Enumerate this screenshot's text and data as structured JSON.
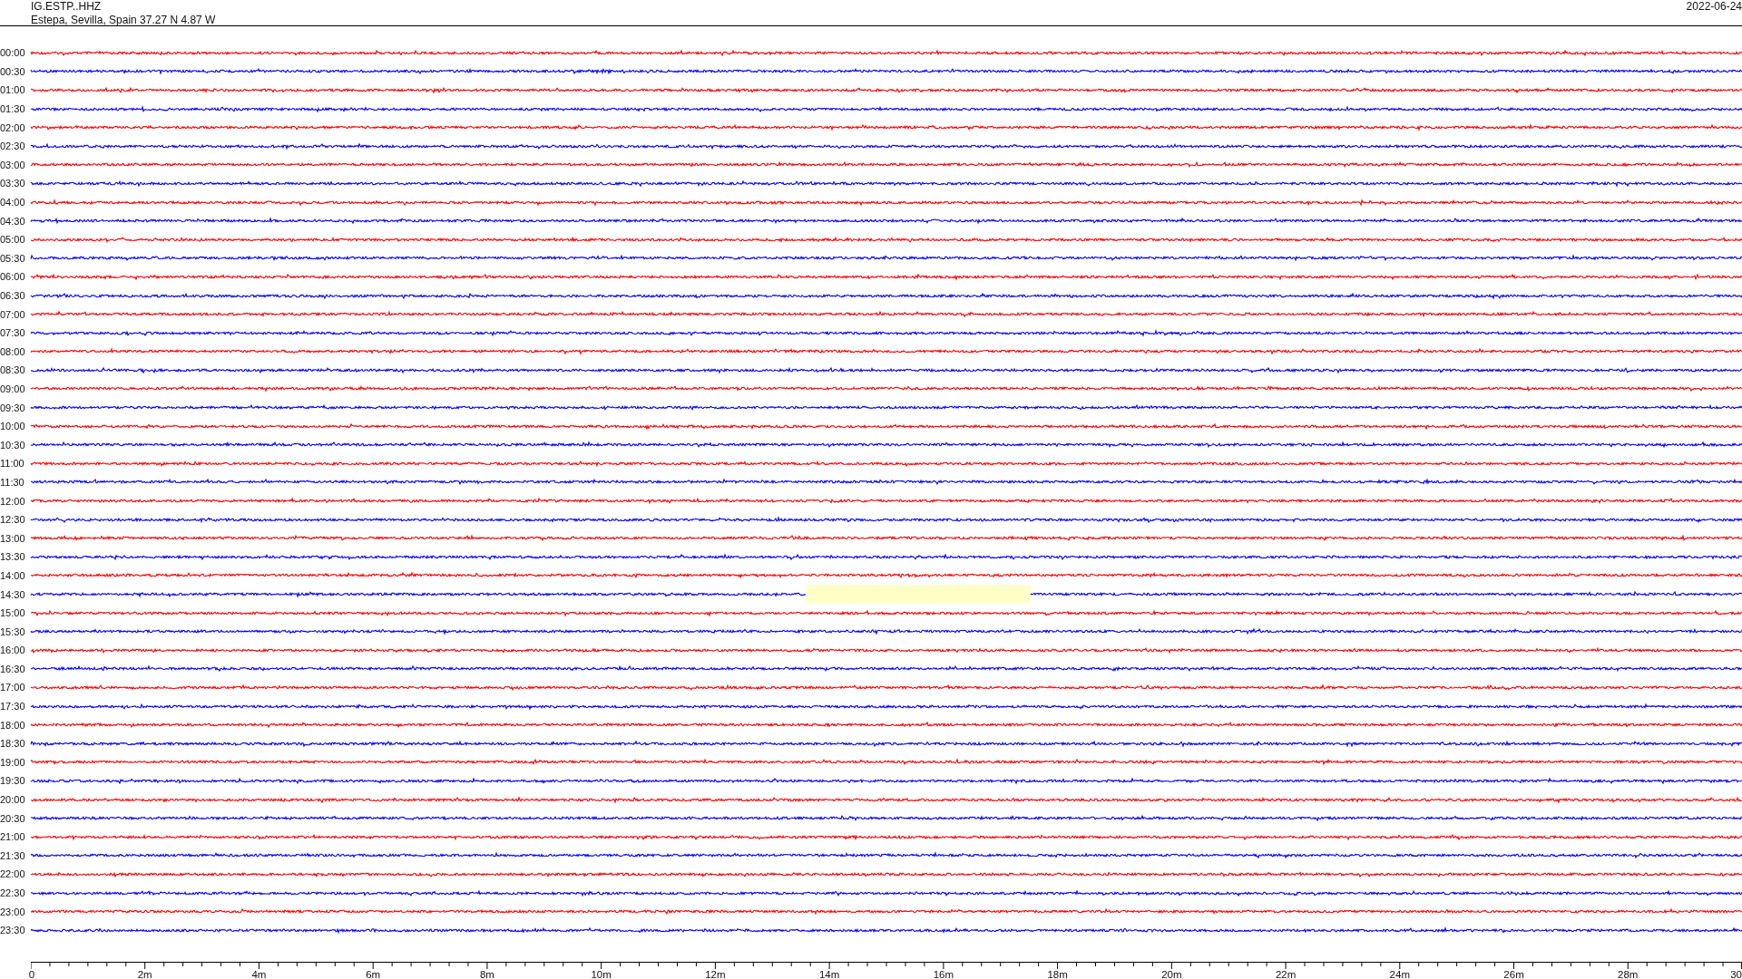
{
  "header": {
    "station": "IG.ESTP..HHZ",
    "location": "Estepa, Sevilla, Spain  37.27 N 4.87 W",
    "date": "2022-06-24"
  },
  "rows": [
    {
      "label": "00:00",
      "color": "#ff0000"
    },
    {
      "label": "00:30",
      "color": "#0000ff"
    },
    {
      "label": "01:00",
      "color": "#ff0000"
    },
    {
      "label": "01:30",
      "color": "#0000ff"
    },
    {
      "label": "02:00",
      "color": "#ff0000"
    },
    {
      "label": "02:30",
      "color": "#0000ff"
    },
    {
      "label": "03:00",
      "color": "#ff0000"
    },
    {
      "label": "03:30",
      "color": "#0000ff"
    },
    {
      "label": "04:00",
      "color": "#ff0000"
    },
    {
      "label": "04:30",
      "color": "#0000ff"
    },
    {
      "label": "05:00",
      "color": "#ff0000"
    },
    {
      "label": "05:30",
      "color": "#0000ff"
    },
    {
      "label": "06:00",
      "color": "#ff0000"
    },
    {
      "label": "06:30",
      "color": "#0000ff"
    },
    {
      "label": "07:00",
      "color": "#ff0000"
    },
    {
      "label": "07:30",
      "color": "#0000ff"
    },
    {
      "label": "08:00",
      "color": "#ff0000"
    },
    {
      "label": "08:30",
      "color": "#0000ff"
    },
    {
      "label": "09:00",
      "color": "#ff0000"
    },
    {
      "label": "09:30",
      "color": "#0000ff"
    },
    {
      "label": "10:00",
      "color": "#ff0000"
    },
    {
      "label": "10:30",
      "color": "#0000ff"
    },
    {
      "label": "11:00",
      "color": "#ff0000"
    },
    {
      "label": "11:30",
      "color": "#0000ff"
    },
    {
      "label": "12:00",
      "color": "#ff0000"
    },
    {
      "label": "12:30",
      "color": "#0000ff"
    },
    {
      "label": "13:00",
      "color": "#ff0000"
    },
    {
      "label": "13:30",
      "color": "#0000ff"
    },
    {
      "label": "14:00",
      "color": "#ff0000"
    },
    {
      "label": "14:30",
      "color": "#0000ff",
      "gap": true
    },
    {
      "label": "15:00",
      "color": "#ff0000"
    },
    {
      "label": "15:30",
      "color": "#0000ff"
    },
    {
      "label": "16:00",
      "color": "#ff0000"
    },
    {
      "label": "16:30",
      "color": "#0000ff"
    },
    {
      "label": "17:00",
      "color": "#ff0000"
    },
    {
      "label": "17:30",
      "color": "#0000ff"
    },
    {
      "label": "18:00",
      "color": "#ff0000"
    },
    {
      "label": "18:30",
      "color": "#0000ff"
    },
    {
      "label": "19:00",
      "color": "#ff0000"
    },
    {
      "label": "19:30",
      "color": "#0000ff"
    },
    {
      "label": "20:00",
      "color": "#ff0000"
    },
    {
      "label": "20:30",
      "color": "#0000ff"
    },
    {
      "label": "21:00",
      "color": "#ff0000"
    },
    {
      "label": "21:30",
      "color": "#0000ff"
    },
    {
      "label": "22:00",
      "color": "#ff0000"
    },
    {
      "label": "22:30",
      "color": "#0000ff"
    },
    {
      "label": "23:00",
      "color": "#ff0000"
    },
    {
      "label": "23:30",
      "color": "#0000ff"
    }
  ],
  "axis_labels": [
    "0",
    "2m",
    "4m",
    "6m",
    "8m",
    "10m",
    "12m",
    "14m",
    "16m",
    "18m",
    "20m",
    "22m",
    "24m",
    "26m",
    "28m",
    "30"
  ]
}
